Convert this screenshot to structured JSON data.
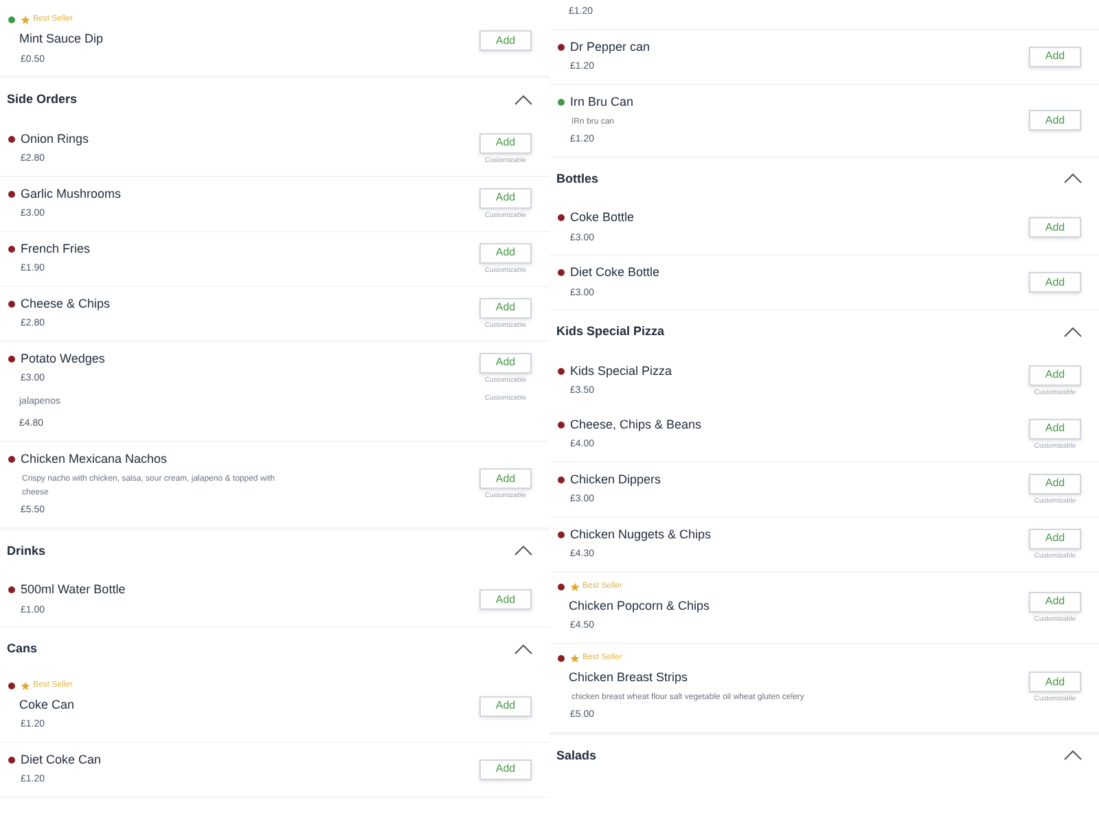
{
  "columns": [
    {
      "entries": [
        {
          "kind": "item",
          "name": "Mint Sauce Dip",
          "price": "£0.50",
          "color": "#3f9a4a",
          "best_seller": true,
          "badge": "Best Seller",
          "button": "Add"
        },
        {
          "kind": "section",
          "title": "Side Orders",
          "expanded": true
        },
        {
          "kind": "item",
          "name": "Onion Rings",
          "price": "£2.80",
          "color": "#8b1e24",
          "button": "Add",
          "note": "Customizable"
        },
        {
          "kind": "item",
          "name": "Garlic Mushrooms",
          "price": "£3.00",
          "color": "#8b1e24",
          "button": "Add",
          "note": "Customizable"
        },
        {
          "kind": "item",
          "name": "French Fries",
          "price": "£1.90",
          "color": "#8b1e24",
          "button": "Add",
          "note": "Customizable"
        },
        {
          "kind": "item",
          "name": "Cheese & Chips",
          "price": "£2.80",
          "color": "#8b1e24",
          "button": "Add",
          "note": "Customizable"
        },
        {
          "kind": "item",
          "name": "Potato Wedges",
          "price": "£3.00",
          "color": "#8b1e24",
          "button": "Add",
          "note": "Customizable",
          "divider": false
        },
        {
          "kind": "partial",
          "description": "jalapenos",
          "price": "£4.80",
          "note": "Customizable"
        },
        {
          "kind": "item",
          "name": "Chicken Mexicana Nachos",
          "description": "Crispy nacho with chicken, salsa, sour cream, jalapeno & topped with cheese",
          "price": "£5.50",
          "color": "#8b1e24",
          "button": "Add",
          "note": "Customizable"
        },
        {
          "kind": "section",
          "title": "Drinks",
          "expanded": true
        },
        {
          "kind": "item",
          "name": "500ml Water Bottle",
          "price": "£1.00",
          "color": "#8b1e24",
          "button": "Add",
          "divider": false
        },
        {
          "kind": "section",
          "title": "Cans",
          "expanded": true
        },
        {
          "kind": "item",
          "name": "Coke Can",
          "price": "£1.20",
          "color": "#8b1e24",
          "best_seller": true,
          "badge": "Best Seller",
          "button": "Add"
        },
        {
          "kind": "item",
          "name": "Diet Coke Can",
          "price": "£1.20",
          "color": "#8b1e24",
          "button": "Add"
        }
      ]
    },
    {
      "entries": [
        {
          "kind": "partial",
          "price": "£1.20"
        },
        {
          "kind": "item",
          "name": "Dr Pepper can",
          "price": "£1.20",
          "color": "#8b1e24",
          "button": "Add"
        },
        {
          "kind": "item",
          "name": "Irn Bru Can",
          "description": "IRn bru can",
          "price": "£1.20",
          "color": "#3f9a4a",
          "button": "Add",
          "divider": false
        },
        {
          "kind": "section",
          "title": "Bottles",
          "expanded": true
        },
        {
          "kind": "item",
          "name": "Coke Bottle",
          "price": "£3.00",
          "color": "#8b1e24",
          "button": "Add"
        },
        {
          "kind": "item",
          "name": "Diet Coke Bottle",
          "price": "£3.00",
          "color": "#8b1e24",
          "button": "Add",
          "divider": false
        },
        {
          "kind": "section",
          "title": "Kids Special Pizza",
          "expanded": true
        },
        {
          "kind": "item",
          "name": "Kids Special Pizza",
          "price": "£3.50",
          "color": "#8b1e24",
          "button": "Add",
          "note": "Customizable",
          "divider": false
        },
        {
          "kind": "item",
          "name": "Cheese, Chips & Beans",
          "price": "£4.00",
          "color": "#8b1e24",
          "button": "Add",
          "note": "Customizable"
        },
        {
          "kind": "item",
          "name": "Chicken Dippers",
          "price": "£3.00",
          "color": "#8b1e24",
          "button": "Add",
          "note": "Customizable"
        },
        {
          "kind": "item",
          "name": "Chicken Nuggets & Chips",
          "price": "£4.30",
          "color": "#8b1e24",
          "button": "Add",
          "note": "Customizable"
        },
        {
          "kind": "item",
          "name": "Chicken Popcorn & Chips",
          "price": "£4.50",
          "color": "#8b1e24",
          "best_seller": true,
          "badge": "Best Seller",
          "button": "Add",
          "note": "Customizable"
        },
        {
          "kind": "item",
          "name": "Chicken Breast Strips",
          "description": "chicken breast wheat flour salt vegetable oil wheat gluten celery",
          "price": "£5.00",
          "color": "#8b1e24",
          "best_seller": true,
          "badge": "Best Seller",
          "button": "Add",
          "note": "Customizable"
        },
        {
          "kind": "section",
          "title": "Salads",
          "expanded": true
        }
      ]
    }
  ]
}
